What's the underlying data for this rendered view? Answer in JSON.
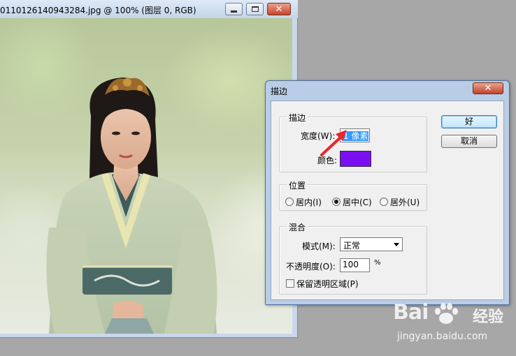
{
  "document": {
    "title": "0110126140943284.jpg @ 100% (图层 0, RGB)"
  },
  "dialog": {
    "title": "描边",
    "stroke_group": {
      "title": "描边",
      "width_label": "宽度(W):",
      "width_value": "1 像素",
      "color_label": "颜色:",
      "color": "#7a10f2"
    },
    "location_group": {
      "title": "位置",
      "options": [
        {
          "label": "居内(I)",
          "selected": false
        },
        {
          "label": "居中(C)",
          "selected": true
        },
        {
          "label": "居外(U)",
          "selected": false
        }
      ]
    },
    "blend_group": {
      "title": "混合",
      "mode_label": "模式(M):",
      "mode_value": "正常",
      "opacity_label": "不透明度(O):",
      "opacity_value": "100",
      "opacity_unit": "%",
      "preserve_label": "保留透明区域(P)",
      "preserve_checked": false
    },
    "ok_label": "好",
    "cancel_label": "取消"
  },
  "annotation": {
    "arrow_color": "#e8262b"
  },
  "watermark": {
    "logo": "Bai",
    "cn": "经验",
    "url": "jingyan.baidu.com"
  }
}
